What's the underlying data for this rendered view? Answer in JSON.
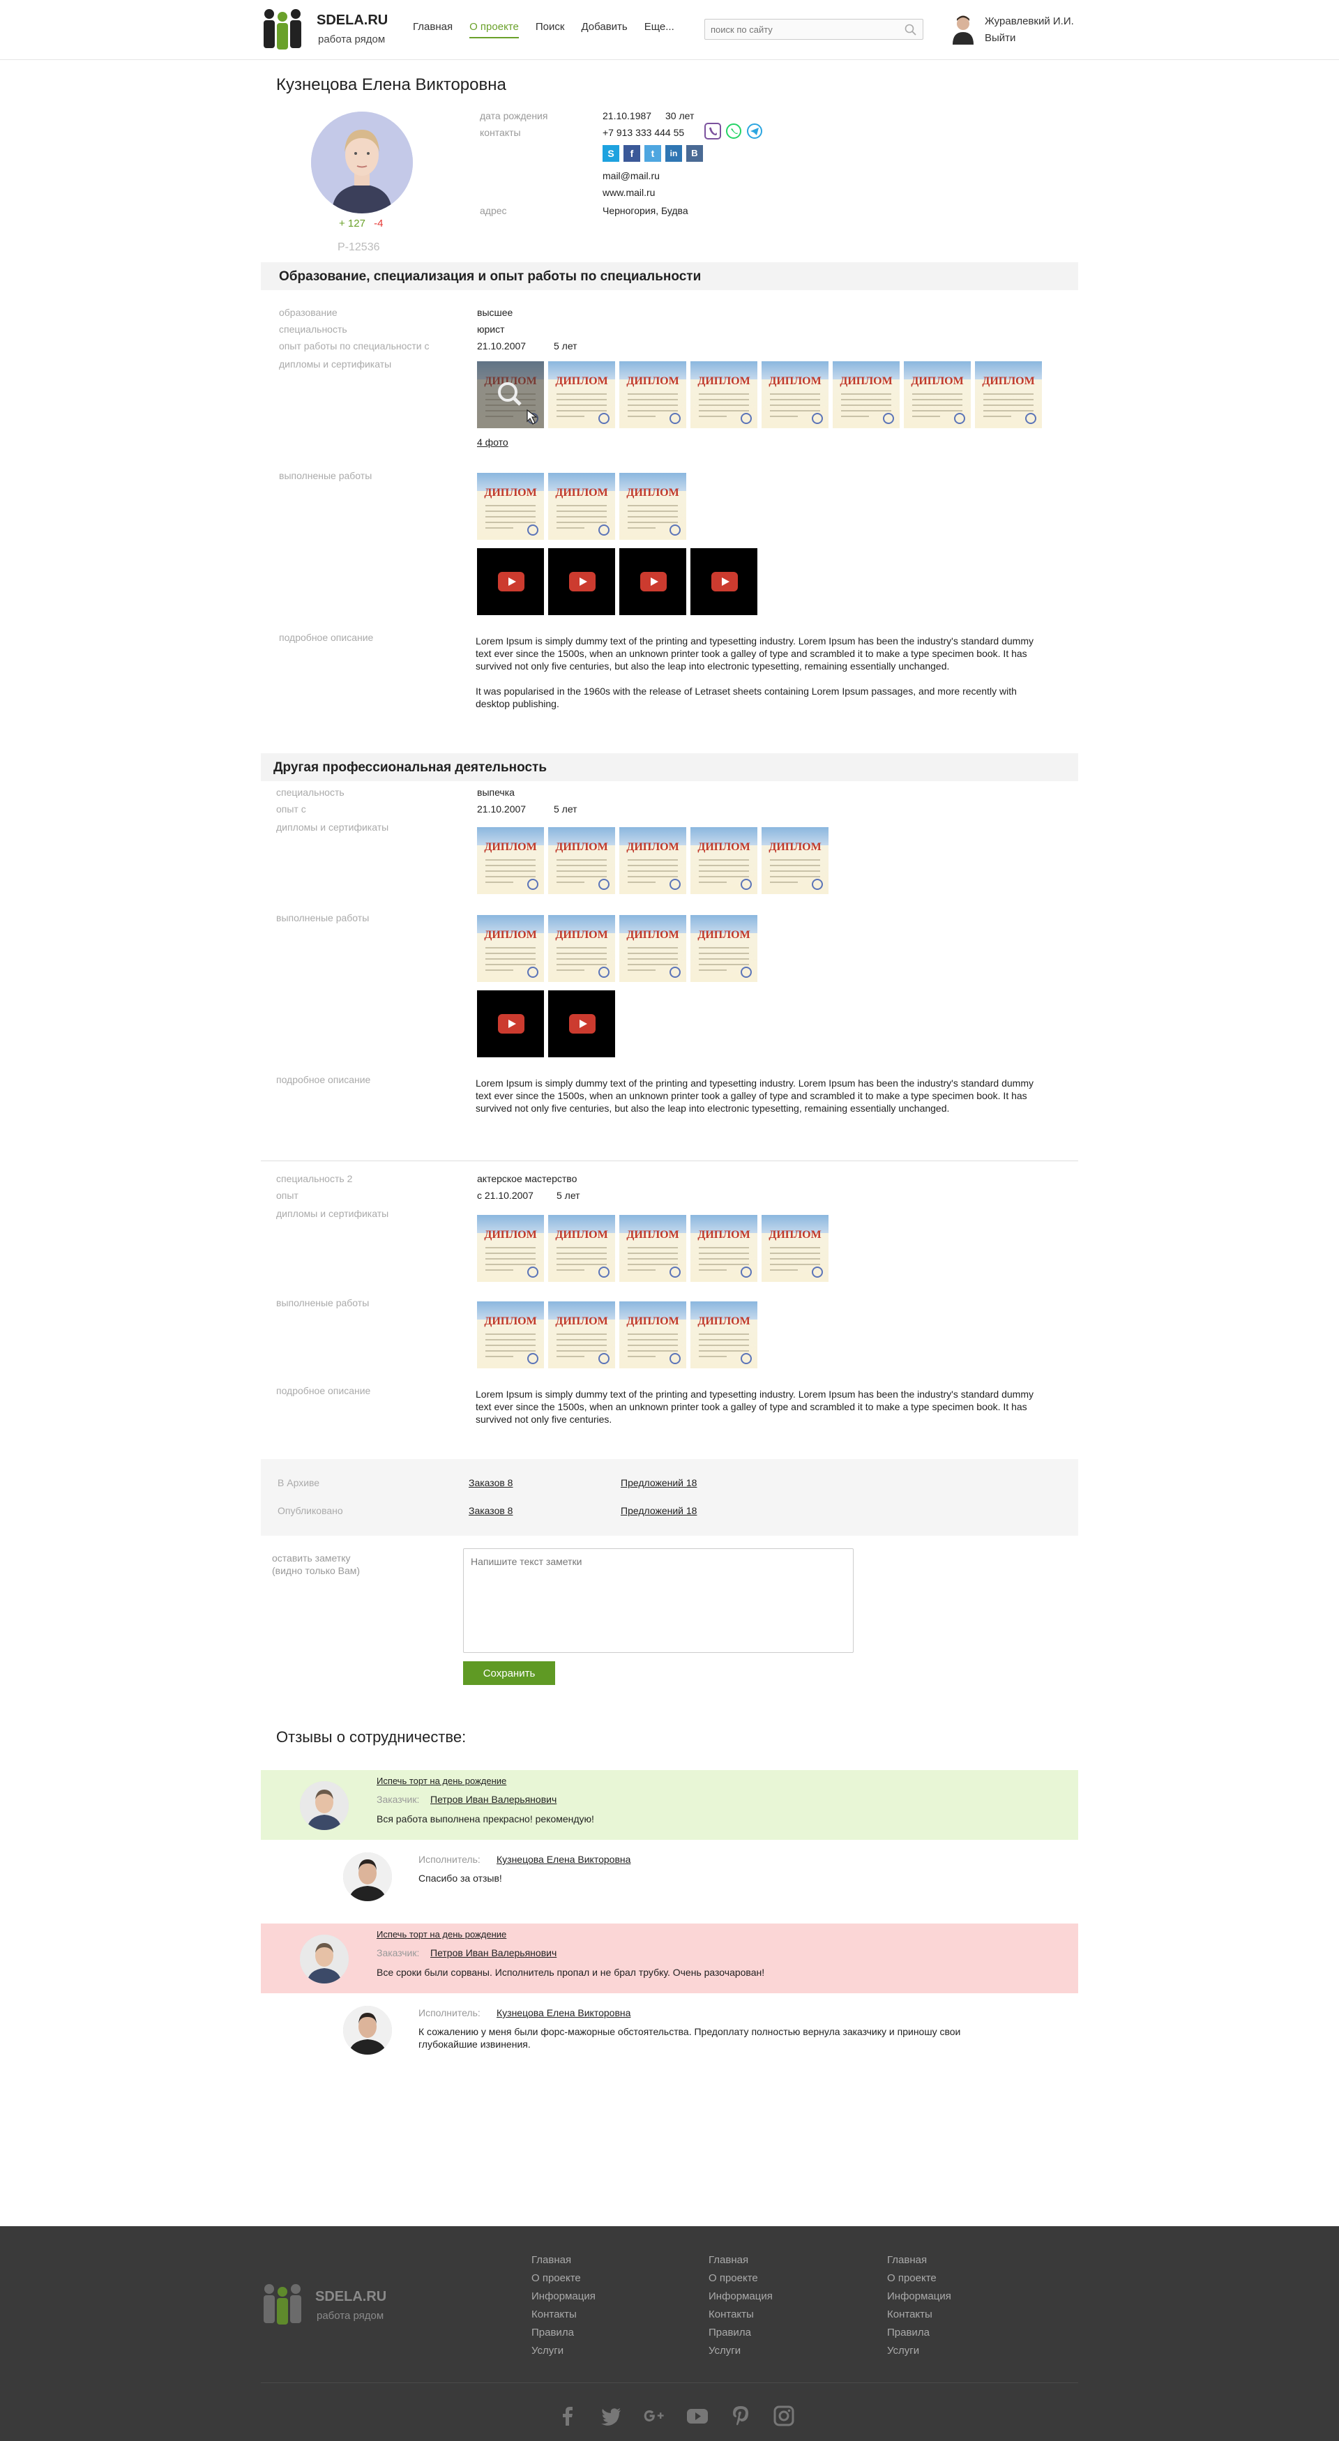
{
  "header": {
    "logo_name": "SDELA.RU",
    "logo_tagline": "работа рядом",
    "nav": [
      "Главная",
      "О проекте",
      "Поиск",
      "Добавить",
      "Еще..."
    ],
    "active_nav": "О проекте",
    "search_placeholder": "поиск по сайту",
    "user_name": "Журавлевкий И.И.",
    "logout": "Выйти"
  },
  "profile": {
    "name": "Кузнецова Елена Викторовна",
    "rating_plus": "+ 127",
    "rating_minus": "-4",
    "id": "P-12536",
    "birth_label": "дата рождения",
    "birth_date": "21.10.1987",
    "age": "30 лет",
    "contacts_label": "контакты",
    "phone": "+7 913 333 444 55",
    "email": "mail@mail.ru",
    "site": "www.mail.ru",
    "address_label": "адрес",
    "address": "Черногория, Будва",
    "messenger_icons": [
      "viber-icon",
      "whatsapp-icon",
      "telegram-icon"
    ],
    "social_icons": [
      "skype-icon",
      "facebook-icon",
      "twitter-icon",
      "linkedin-icon",
      "vk-icon"
    ],
    "social_letters": [
      "S",
      "f",
      "t",
      "in",
      "В"
    ]
  },
  "education": {
    "title": "Образование, специализация и опыт работы по специальности",
    "education_label": "образование",
    "education_value": "высшее",
    "specialty_label": "специальность",
    "specialty_value": "юрист",
    "experience_label": "опыт работы по специальности с",
    "experience_date": "21.10.2007",
    "experience_years": "5 лет",
    "diplomas_label": "дипломы и сертификаты",
    "diploma_text": "ДИПЛОМ",
    "photos_link": "4 фото",
    "works_label": "выполненые работы",
    "description_label": "подробное описание",
    "description_p1": "Lorem Ipsum is simply dummy text of the printing and typesetting industry. Lorem Ipsum has been the industry's standard dummy text ever since the 1500s, when an unknown printer took a galley of type and scrambled it to make a type specimen book. It has survived not only five centuries, but also the leap into electronic typesetting, remaining essentially unchanged.",
    "description_p2": "It was popularised in the 1960s with the release of Letraset sheets containing Lorem Ipsum passages, and more recently with desktop publishing."
  },
  "other": {
    "title": "Другая профессиональная деятельность",
    "specialty_label": "специальность",
    "specialty_value": "выпечка",
    "since_label": "опыт с",
    "since_date": "21.10.2007",
    "since_years": "5 лет",
    "diplomas_label": "дипломы и сертификаты",
    "works_label": "выполненые работы",
    "description_label": "подробное описание",
    "description": "Lorem Ipsum is simply dummy text of the printing and typesetting industry. Lorem Ipsum has been the industry's standard dummy text ever since the 1500s, when an unknown printer took a galley of type and scrambled it to make a type specimen book. It has survived not only five centuries, but also the leap into electronic typesetting, remaining essentially unchanged."
  },
  "specialty2": {
    "label": "специальность 2",
    "value": "актерское мастерство",
    "exp_label": "опыт",
    "exp_value": "с 21.10.2007",
    "exp_years": "5 лет",
    "diplomas_label": "дипломы и сертификаты",
    "works_label": "выполненые работы",
    "description_label": "подробное описание",
    "description": "Lorem Ipsum is simply dummy text of the printing and typesetting industry. Lorem Ipsum has been the industry's standard dummy text ever since the 1500s, when an unknown printer took a galley of type and scrambled it to make a type specimen book. It has survived not only five centuries."
  },
  "stats": {
    "archive_label": "В Архиве",
    "published_label": "Опубликовано",
    "archive_orders": "Заказов 8",
    "archive_offers": "Предложений 18",
    "published_orders": "Заказов 8",
    "published_offers": "Предложений 18"
  },
  "note": {
    "label_line1": "оставить заметку",
    "label_line2": "(видно только Вам)",
    "placeholder": "Напишите текст заметки",
    "save_label": "Сохранить"
  },
  "reviews": {
    "title": "Отзывы о сотрудничестве:",
    "items": [
      {
        "task": "Испечь торт на день рождение",
        "customer_label": "Заказчик:",
        "customer": "Петров Иван Валерьянович",
        "text": "Вся работа выполнена прекрасно! рекомендую!",
        "color": "#e8f6d6",
        "reply": {
          "label": "Исполнитель:",
          "name": "Кузнецова Елена Викторовна",
          "text": "Спасибо за отзыв!"
        }
      },
      {
        "task": "Испечь торт на день рождение",
        "customer_label": "Заказчик:",
        "customer": "Петров Иван Валерьянович",
        "text": "Все сроки были сорваны. Исполнитель пропал и не брал трубку. Очень разочарован!",
        "color": "#fbd6d6",
        "reply": {
          "label": "Исполнитель:",
          "name": "Кузнецова Елена Викторовна",
          "text": "К сожалению у меня были форс-мажорные обстоятельства. Предоплату полностью вернула заказчику и приношу свои глубокайшие извинения."
        }
      }
    ]
  },
  "footer": {
    "logo_name": "SDELA.RU",
    "logo_tagline": "работа рядом",
    "columns": [
      [
        "Главная",
        "О проекте",
        "Информация",
        "Контакты",
        "Правила",
        "Услуги"
      ],
      [
        "Главная",
        "О проекте",
        "Информация",
        "Контакты",
        "Правила",
        "Услуги"
      ],
      [
        "Главная",
        "О проекте",
        "Информация",
        "Контакты",
        "Правила",
        "Услуги"
      ]
    ],
    "social": [
      "facebook-icon",
      "twitter-icon",
      "google-plus-icon",
      "youtube-icon",
      "pinterest-icon",
      "instagram-icon"
    ]
  },
  "colors": {
    "accent": "#6aa12a",
    "button": "#5f9a24",
    "positive_review": "#e8f6d6",
    "negative_review": "#fbd6d6",
    "footer": "#3a3a3a"
  }
}
